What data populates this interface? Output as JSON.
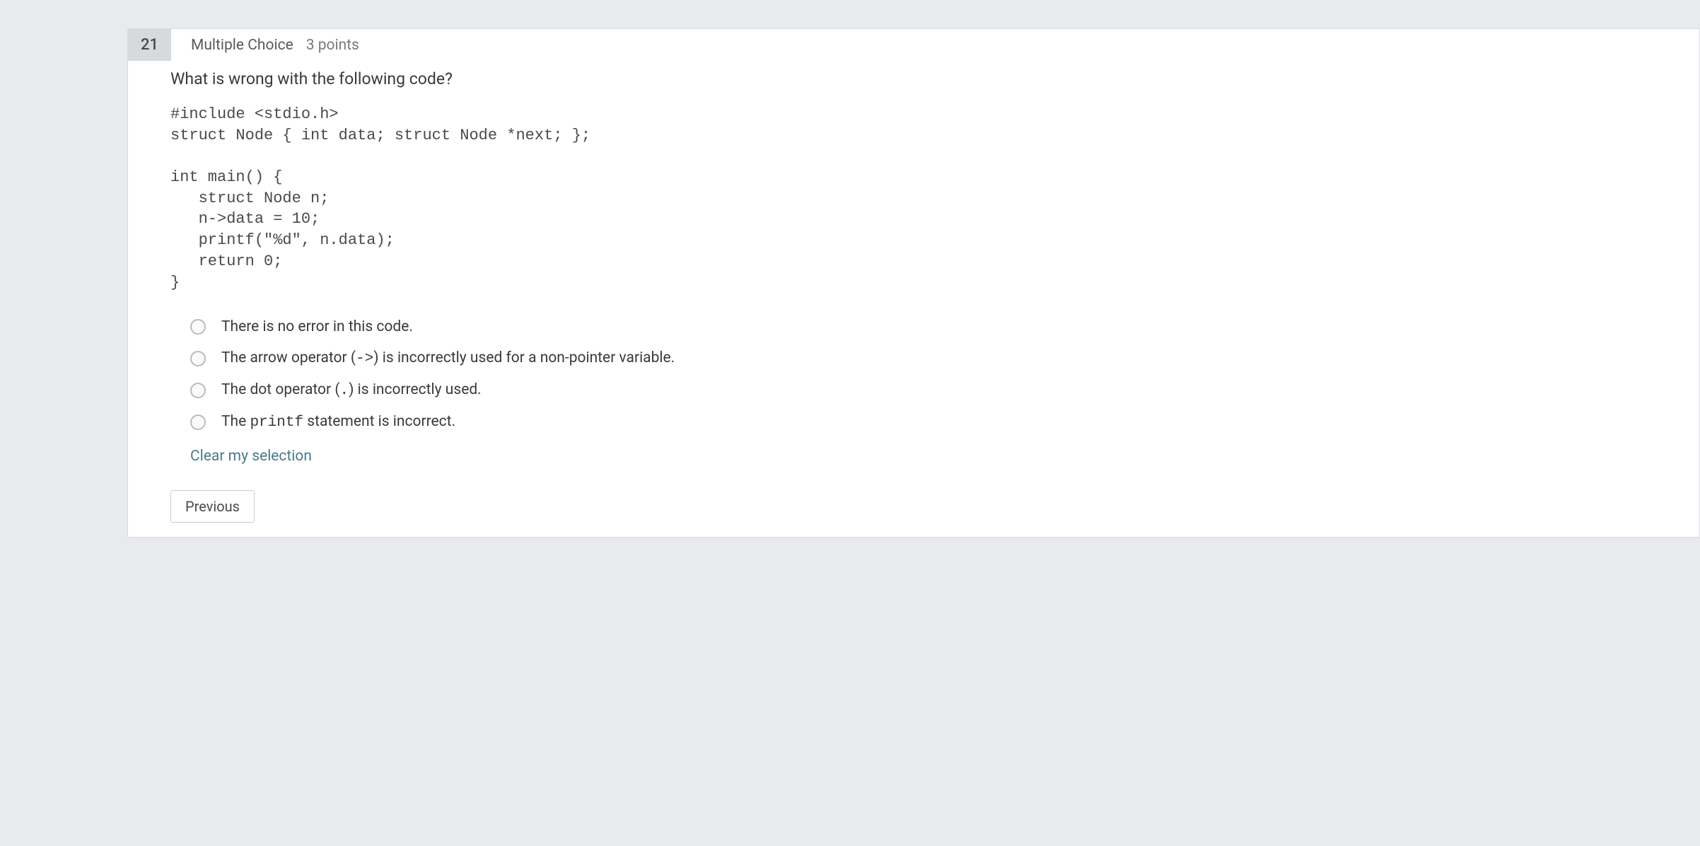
{
  "question": {
    "number": "21",
    "type": "Multiple Choice",
    "points": "3 points",
    "prompt": "What is wrong with the following code?",
    "code": "#include <stdio.h>\nstruct Node { int data; struct Node *next; };\n\nint main() {\n   struct Node n;\n   n->data = 10;\n   printf(\"%d\", n.data);\n   return 0;\n}",
    "options": [
      {
        "text": "There is no error in this code."
      },
      {
        "text_pre": "The arrow operator (",
        "mono": "->",
        "text_post": ") is incorrectly used for a non-pointer variable."
      },
      {
        "text_pre": "The dot operator (",
        "mono": ".",
        "text_post": ") is incorrectly used."
      },
      {
        "text_pre": "The ",
        "mono": "printf",
        "text_post": " statement is incorrect."
      }
    ],
    "clear_label": "Clear my selection"
  },
  "nav": {
    "previous_label": "Previous"
  }
}
